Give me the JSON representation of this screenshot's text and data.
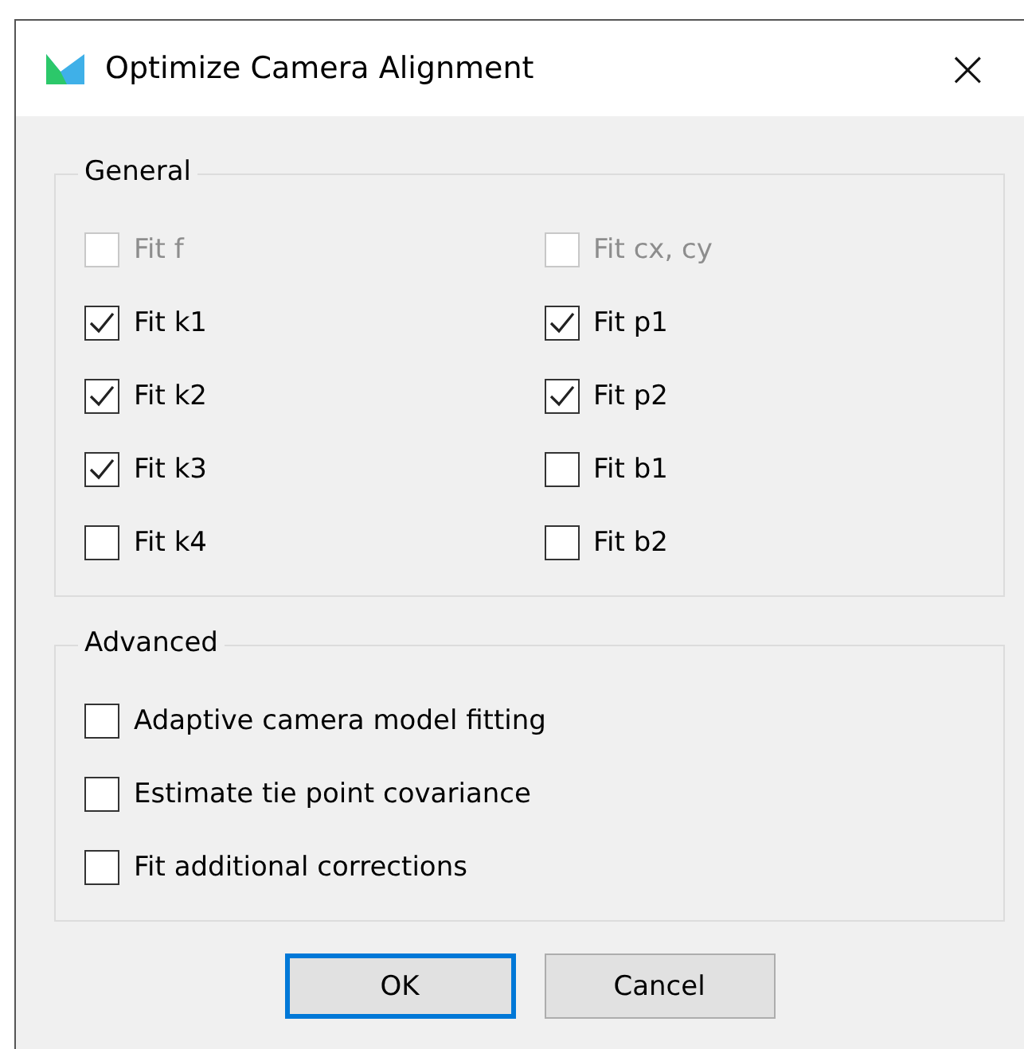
{
  "window": {
    "title": "Optimize Camera Alignment",
    "close": "×"
  },
  "general": {
    "title": "General",
    "options": [
      {
        "label": "Fit f",
        "checked": false,
        "disabled": true
      },
      {
        "label": "Fit cx, cy",
        "checked": false,
        "disabled": true
      },
      {
        "label": "Fit k1",
        "checked": true,
        "disabled": false
      },
      {
        "label": "Fit p1",
        "checked": true,
        "disabled": false
      },
      {
        "label": "Fit k2",
        "checked": true,
        "disabled": false
      },
      {
        "label": "Fit p2",
        "checked": true,
        "disabled": false
      },
      {
        "label": "Fit k3",
        "checked": true,
        "disabled": false
      },
      {
        "label": "Fit b1",
        "checked": false,
        "disabled": false
      },
      {
        "label": "Fit k4",
        "checked": false,
        "disabled": false
      },
      {
        "label": "Fit b2",
        "checked": false,
        "disabled": false
      }
    ]
  },
  "advanced": {
    "title": "Advanced",
    "options": [
      {
        "label": "Adaptive camera model fitting",
        "checked": false,
        "disabled": false
      },
      {
        "label": "Estimate tie point covariance",
        "checked": false,
        "disabled": false
      },
      {
        "label": "Fit additional corrections",
        "checked": false,
        "disabled": false
      }
    ]
  },
  "buttons": [
    {
      "label": "OK",
      "focused": true
    },
    {
      "label": "Cancel",
      "focused": false
    }
  ]
}
